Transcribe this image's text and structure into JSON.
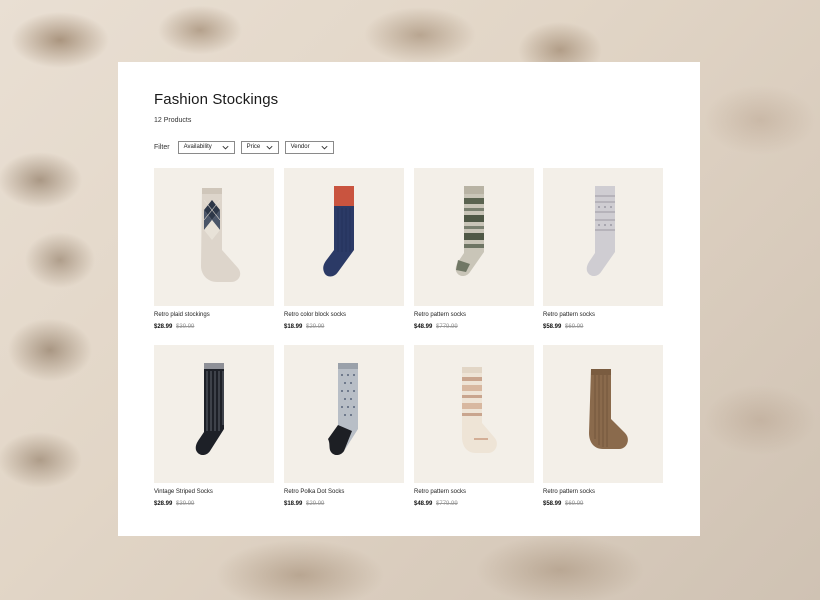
{
  "collection": {
    "title": "Fashion Stockings",
    "product_count": "12 Products"
  },
  "filters": {
    "label": "Filter",
    "options": [
      "Availability",
      "Price",
      "Vendor"
    ]
  },
  "products": [
    {
      "name": "Retro plaid stockings",
      "price": "$28.99",
      "compare_price": "$39.99",
      "style": "argyle"
    },
    {
      "name": "Retro color block socks",
      "price": "$18.99",
      "compare_price": "$29.99",
      "style": "colorblock"
    },
    {
      "name": "Retro pattern socks",
      "price": "$48.99",
      "compare_price": "$779.99",
      "style": "fairisle-grey"
    },
    {
      "name": "Retro pattern socks",
      "price": "$58.99",
      "compare_price": "$69.99",
      "style": "grey-knit"
    },
    {
      "name": "Vintage Striped Socks",
      "price": "$28.99",
      "compare_price": "$39.99",
      "style": "striped"
    },
    {
      "name": "Retro Polka Dot Socks",
      "price": "$18.99",
      "compare_price": "$29.99",
      "style": "polkadot"
    },
    {
      "name": "Retro pattern socks",
      "price": "$48.99",
      "compare_price": "$779.99",
      "style": "fairisle-cream"
    },
    {
      "name": "Retro pattern socks",
      "price": "$58.99",
      "compare_price": "$69.99",
      "style": "brown-ribbed"
    }
  ],
  "colors": {
    "panel_bg": "#ffffff",
    "image_bg": "#f3efe8",
    "text": "#1a1a1a",
    "muted": "#999999"
  },
  "icons": {
    "filter_chevron": "chevron-down-icon"
  }
}
